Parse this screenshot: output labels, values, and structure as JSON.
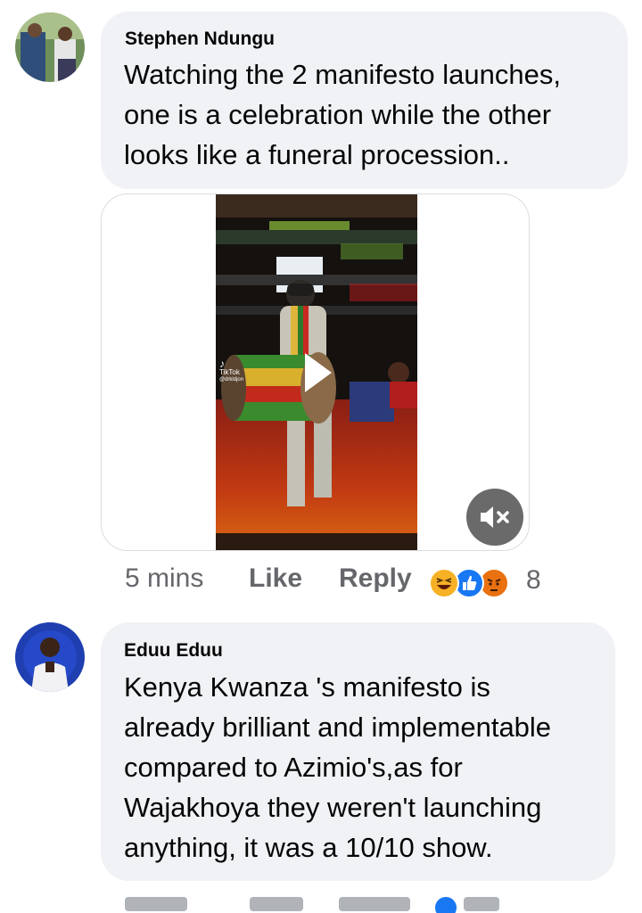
{
  "comments": [
    {
      "author": "Stephen Ndungu",
      "text": "Watching the 2 manifesto launches,\none is a celebration while the other\nlooks like a funeral procession..",
      "time": "5 mins",
      "like_label": "Like",
      "reply_label": "Reply",
      "reaction_count": "8",
      "reactions": [
        "haha-icon",
        "like-icon",
        "angry-icon"
      ],
      "media": {
        "watermark": "TikTok",
        "watermark_handle": "@drkldjon"
      }
    },
    {
      "author": "Eduu Eduu",
      "text": "Kenya Kwanza 's manifesto is\nalready brilliant and implementable\ncompared to Azimio's,as for\nWajakhoya they weren't launching\nanything, it was a 10/10 show."
    }
  ],
  "colors": {
    "bubble": "#f0f2f5",
    "meta_text": "#65676b",
    "like_blue": "#1877f2",
    "haha_yellow": "#f7b125",
    "angry_orange": "#e9710f"
  }
}
